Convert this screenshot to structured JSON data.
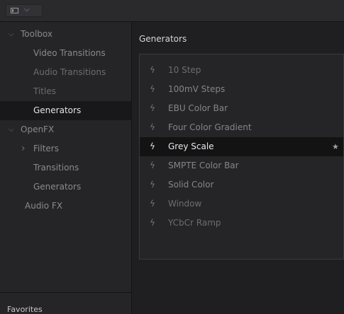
{
  "toolbar": {
    "panel_icon": "panel-layout-icon",
    "chevron": "⌵"
  },
  "sidebar": {
    "items": [
      {
        "label": "Toolbox",
        "expanded": true,
        "chevron": "⌵"
      },
      {
        "label": "Video Transitions"
      },
      {
        "label": "Audio Transitions"
      },
      {
        "label": "Titles"
      },
      {
        "label": "Generators",
        "selected": true
      },
      {
        "label": "OpenFX",
        "expanded": true,
        "chevron": "⌵"
      },
      {
        "label": "Filters",
        "chevron": "›"
      },
      {
        "label": "Transitions"
      },
      {
        "label": "Generators"
      },
      {
        "label": "Audio FX"
      }
    ],
    "favorites_label": "Favorites"
  },
  "main": {
    "title": "Generators",
    "items": [
      {
        "label": "10 Step",
        "icon": "lightning-bolt-icon"
      },
      {
        "label": "100mV Steps",
        "icon": "lightning-bolt-icon"
      },
      {
        "label": "EBU Color Bar",
        "icon": "lightning-bolt-icon"
      },
      {
        "label": "Four Color Gradient",
        "icon": "lightning-bolt-icon"
      },
      {
        "label": "Grey Scale",
        "icon": "lightning-bolt-icon",
        "selected": true,
        "favorite_icon": "star-icon"
      },
      {
        "label": "SMPTE Color Bar",
        "icon": "lightning-bolt-icon"
      },
      {
        "label": "Solid Color",
        "icon": "lightning-bolt-icon"
      },
      {
        "label": "Window",
        "icon": "lightning-bolt-icon"
      },
      {
        "label": "YCbCr Ramp",
        "icon": "lightning-bolt-icon"
      }
    ]
  },
  "colors": {
    "background": "#1c1c1e",
    "sidebar": "#252528",
    "selected_row": "#131314",
    "text": "#8a8a8d",
    "selected_text": "#e8e8ea"
  }
}
